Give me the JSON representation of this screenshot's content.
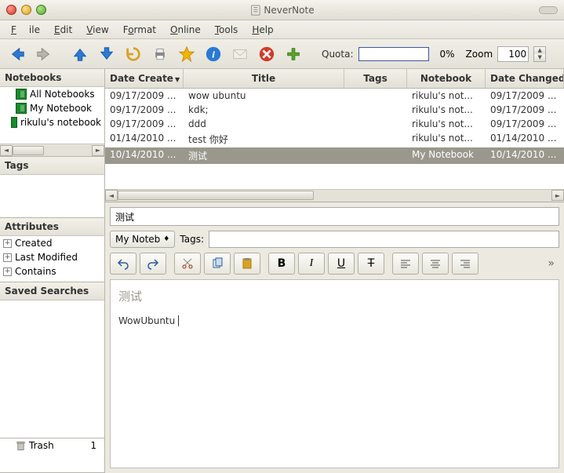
{
  "window": {
    "title": "NeverNote"
  },
  "menubar": {
    "file": "File",
    "edit": "Edit",
    "view": "View",
    "format": "Format",
    "online": "Online",
    "tools": "Tools",
    "help": "Help"
  },
  "toolbar": {
    "quota_label": "Quota:",
    "quota_pct": "0%",
    "zoom_label": "Zoom",
    "zoom_value": "100"
  },
  "sidebar": {
    "notebooks": {
      "header": "Notebooks",
      "items": [
        {
          "label": "All Notebooks"
        },
        {
          "label": "My Notebook"
        },
        {
          "label": "rikulu's notebook"
        }
      ]
    },
    "tags": {
      "header": "Tags"
    },
    "attributes": {
      "header": "Attributes",
      "items": [
        {
          "label": "Created"
        },
        {
          "label": "Last Modified"
        },
        {
          "label": "Contains"
        }
      ]
    },
    "saved_searches": {
      "header": "Saved Searches"
    },
    "trash": {
      "header": "Trash",
      "count": "1"
    }
  },
  "table": {
    "columns": {
      "date_created": "Date Created",
      "title": "Title",
      "tags": "Tags",
      "notebook": "Notebook",
      "date_changed": "Date Changed"
    },
    "rows": [
      {
        "date": "09/17/2009 ...",
        "title": "wow ubuntu",
        "tags": "",
        "notebook": "rikulu's not...",
        "changed": "09/17/2009 ..."
      },
      {
        "date": "09/17/2009 ...",
        "title": "kdk;",
        "tags": "",
        "notebook": "rikulu's not...",
        "changed": "09/17/2009 ..."
      },
      {
        "date": "09/17/2009 ...",
        "title": "ddd",
        "tags": "",
        "notebook": "rikulu's not...",
        "changed": "09/17/2009 ..."
      },
      {
        "date": "01/14/2010 ...",
        "title": "test 你好",
        "tags": "",
        "notebook": "rikulu's not...",
        "changed": "01/14/2010 ..."
      },
      {
        "date": "10/14/2010 ...",
        "title": "测试",
        "tags": "",
        "notebook": "My Notebook",
        "changed": "10/14/2010 ..."
      }
    ],
    "selected_index": 4
  },
  "editor": {
    "title_value": "测试",
    "notebook_combo": "My Noteb",
    "tags_label": "Tags:",
    "body_title": "测试",
    "body_text": "WowUbuntu"
  }
}
